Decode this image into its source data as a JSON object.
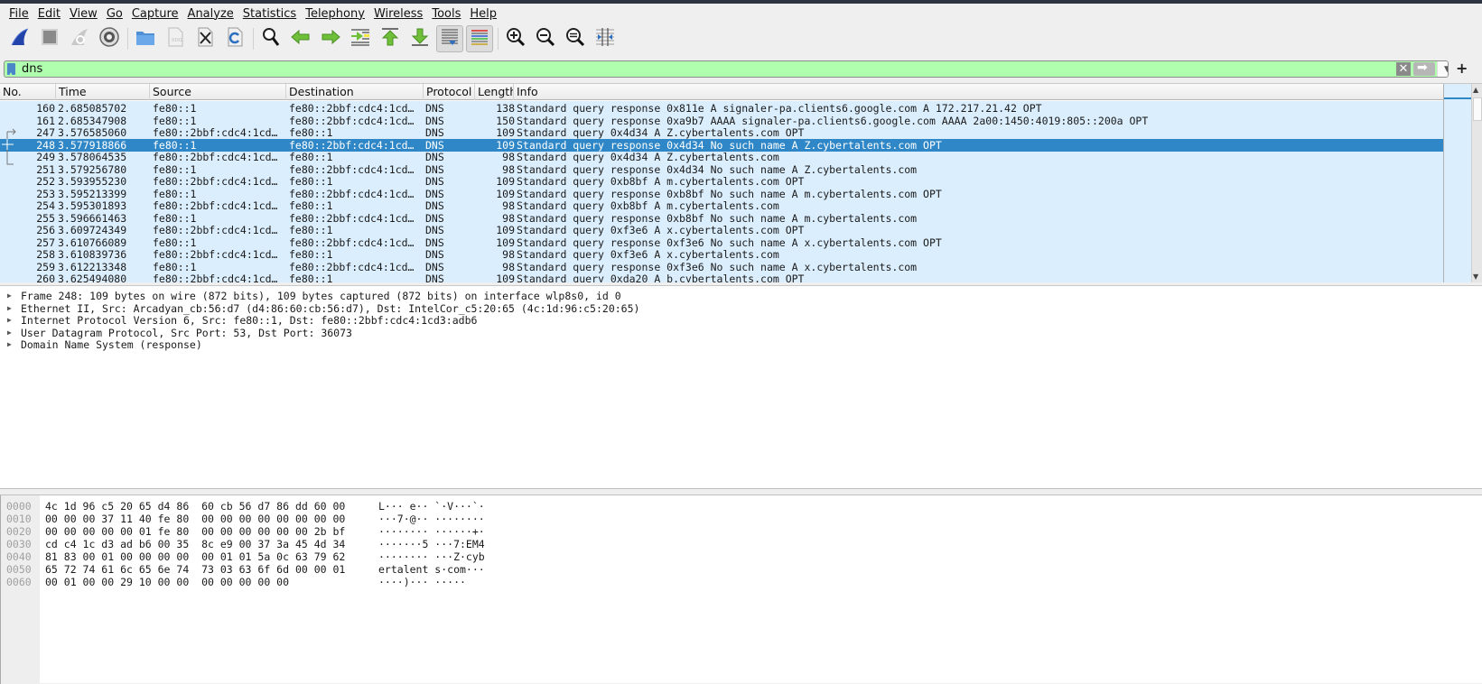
{
  "menu": [
    "File",
    "Edit",
    "View",
    "Go",
    "Capture",
    "Analyze",
    "Statistics",
    "Telephony",
    "Wireless",
    "Tools",
    "Help"
  ],
  "toolbar": [
    {
      "name": "start-capture-icon"
    },
    {
      "name": "stop-capture-icon"
    },
    {
      "name": "restart-capture-icon"
    },
    {
      "name": "capture-options-icon"
    },
    {
      "sep": true
    },
    {
      "name": "open-file-icon"
    },
    {
      "name": "save-file-icon"
    },
    {
      "name": "close-file-icon"
    },
    {
      "name": "reload-file-icon"
    },
    {
      "sep": true
    },
    {
      "name": "find-packet-icon"
    },
    {
      "name": "go-back-icon"
    },
    {
      "name": "go-forward-icon"
    },
    {
      "name": "go-to-packet-icon"
    },
    {
      "name": "go-first-packet-icon"
    },
    {
      "name": "go-last-packet-icon"
    },
    {
      "name": "auto-scroll-icon",
      "pressed": true
    },
    {
      "name": "colorize-icon",
      "pressed": true
    },
    {
      "sep": true
    },
    {
      "name": "zoom-in-icon"
    },
    {
      "name": "zoom-out-icon"
    },
    {
      "name": "zoom-normal-icon"
    },
    {
      "name": "resize-columns-icon"
    }
  ],
  "filter": {
    "value": "dns",
    "clear_label": "✕",
    "add_label": "+"
  },
  "columns": [
    "No.",
    "Time",
    "Source",
    "Destination",
    "Protocol",
    "Length",
    "Info"
  ],
  "packets": [
    {
      "no": "160",
      "time": "2.685085702",
      "src": "fe80::1",
      "dst": "fe80::2bbf:cdc4:1cd…",
      "proto": "DNS",
      "len": "138",
      "info": "Standard query response 0x811e A signaler-pa.clients6.google.com A 172.217.21.42 OPT"
    },
    {
      "no": "161",
      "time": "2.685347908",
      "src": "fe80::1",
      "dst": "fe80::2bbf:cdc4:1cd…",
      "proto": "DNS",
      "len": "150",
      "info": "Standard query response 0xa9b7 AAAA signaler-pa.clients6.google.com AAAA 2a00:1450:4019:805::200a OPT"
    },
    {
      "no": "247",
      "time": "3.576585060",
      "src": "fe80::2bbf:cdc4:1cd…",
      "dst": "fe80::1",
      "proto": "DNS",
      "len": "109",
      "info": "Standard query 0x4d34 A Z.cybertalents.com OPT"
    },
    {
      "no": "248",
      "time": "3.577918866",
      "src": "fe80::1",
      "dst": "fe80::2bbf:cdc4:1cd…",
      "proto": "DNS",
      "len": "109",
      "info": "Standard query response 0x4d34 No such name A Z.cybertalents.com OPT",
      "selected": true
    },
    {
      "no": "249",
      "time": "3.578064535",
      "src": "fe80::2bbf:cdc4:1cd…",
      "dst": "fe80::1",
      "proto": "DNS",
      "len": "98",
      "info": "Standard query 0x4d34 A Z.cybertalents.com"
    },
    {
      "no": "251",
      "time": "3.579256780",
      "src": "fe80::1",
      "dst": "fe80::2bbf:cdc4:1cd…",
      "proto": "DNS",
      "len": "98",
      "info": "Standard query response 0x4d34 No such name A Z.cybertalents.com"
    },
    {
      "no": "252",
      "time": "3.593955230",
      "src": "fe80::2bbf:cdc4:1cd…",
      "dst": "fe80::1",
      "proto": "DNS",
      "len": "109",
      "info": "Standard query 0xb8bf A m.cybertalents.com OPT"
    },
    {
      "no": "253",
      "time": "3.595213399",
      "src": "fe80::1",
      "dst": "fe80::2bbf:cdc4:1cd…",
      "proto": "DNS",
      "len": "109",
      "info": "Standard query response 0xb8bf No such name A m.cybertalents.com OPT"
    },
    {
      "no": "254",
      "time": "3.595301893",
      "src": "fe80::2bbf:cdc4:1cd…",
      "dst": "fe80::1",
      "proto": "DNS",
      "len": "98",
      "info": "Standard query 0xb8bf A m.cybertalents.com"
    },
    {
      "no": "255",
      "time": "3.596661463",
      "src": "fe80::1",
      "dst": "fe80::2bbf:cdc4:1cd…",
      "proto": "DNS",
      "len": "98",
      "info": "Standard query response 0xb8bf No such name A m.cybertalents.com"
    },
    {
      "no": "256",
      "time": "3.609724349",
      "src": "fe80::2bbf:cdc4:1cd…",
      "dst": "fe80::1",
      "proto": "DNS",
      "len": "109",
      "info": "Standard query 0xf3e6 A x.cybertalents.com OPT"
    },
    {
      "no": "257",
      "time": "3.610766089",
      "src": "fe80::1",
      "dst": "fe80::2bbf:cdc4:1cd…",
      "proto": "DNS",
      "len": "109",
      "info": "Standard query response 0xf3e6 No such name A x.cybertalents.com OPT"
    },
    {
      "no": "258",
      "time": "3.610839736",
      "src": "fe80::2bbf:cdc4:1cd…",
      "dst": "fe80::1",
      "proto": "DNS",
      "len": "98",
      "info": "Standard query 0xf3e6 A x.cybertalents.com"
    },
    {
      "no": "259",
      "time": "3.612213348",
      "src": "fe80::1",
      "dst": "fe80::2bbf:cdc4:1cd…",
      "proto": "DNS",
      "len": "98",
      "info": "Standard query response 0xf3e6 No such name A x.cybertalents.com"
    },
    {
      "no": "260",
      "time": "3.625494080",
      "src": "fe80::2bbf:cdc4:1cd…",
      "dst": "fe80::1",
      "proto": "DNS",
      "len": "109",
      "info": "Standard query 0xda20 A b.cybertalents.com OPT"
    }
  ],
  "details": [
    "Frame 248: 109 bytes on wire (872 bits), 109 bytes captured (872 bits) on interface wlp8s0, id 0",
    "Ethernet II, Src: Arcadyan_cb:56:d7 (d4:86:60:cb:56:d7), Dst: IntelCor_c5:20:65 (4c:1d:96:c5:20:65)",
    "Internet Protocol Version 6, Src: fe80::1, Dst: fe80::2bbf:cdc4:1cd3:adb6",
    "User Datagram Protocol, Src Port: 53, Dst Port: 36073",
    "Domain Name System (response)"
  ],
  "hexdump": [
    {
      "offset": "0000",
      "hex": "4c 1d 96 c5 20 65 d4 86  60 cb 56 d7 86 dd 60 00",
      "ascii": "L··· e·· `·V···`·"
    },
    {
      "offset": "0010",
      "hex": "00 00 00 37 11 40 fe 80  00 00 00 00 00 00 00 00",
      "ascii": "···7·@·· ········"
    },
    {
      "offset": "0020",
      "hex": "00 00 00 00 00 01 fe 80  00 00 00 00 00 00 2b bf",
      "ascii": "········ ······+·"
    },
    {
      "offset": "0030",
      "hex": "cd c4 1c d3 ad b6 00 35  8c e9 00 37 3a 45 4d 34",
      "ascii": "·······5 ···7:EM4"
    },
    {
      "offset": "0040",
      "hex": "81 83 00 01 00 00 00 00  00 01 01 5a 0c 63 79 62",
      "ascii": "········ ···Z·cyb"
    },
    {
      "offset": "0050",
      "hex": "65 72 74 61 6c 65 6e 74  73 03 63 6f 6d 00 00 01",
      "ascii": "ertalent s·com···"
    },
    {
      "offset": "0060",
      "hex": "00 01 00 00 29 10 00 00  00 00 00 00 00",
      "ascii": "····)··· ·····"
    }
  ]
}
